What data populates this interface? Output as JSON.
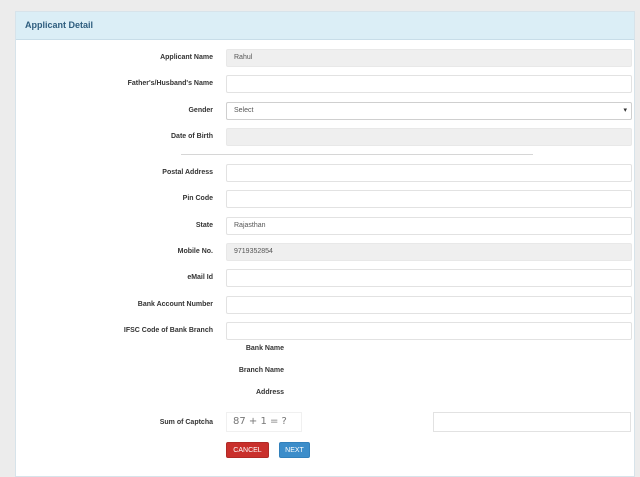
{
  "panel": {
    "title": "Applicant Detail"
  },
  "form": {
    "applicant_name": {
      "label": "Applicant Name",
      "value": "Rahul"
    },
    "father_name": {
      "label": "Father's/Husband's Name",
      "value": ""
    },
    "gender": {
      "label": "Gender",
      "value": "Select",
      "caret": "▾"
    },
    "dob": {
      "label": "Date of Birth",
      "value": ""
    },
    "postal_address": {
      "label": "Postal Address",
      "value": ""
    },
    "pin_code": {
      "label": "Pin Code",
      "value": ""
    },
    "state": {
      "label": "State",
      "value": "Rajasthan"
    },
    "mobile": {
      "label": "Mobile No.",
      "value": "9719352854"
    },
    "email": {
      "label": "eMail Id",
      "value": ""
    },
    "bank_account": {
      "label": "Bank Account Number",
      "value": ""
    },
    "ifsc": {
      "label": "IFSC Code of Bank Branch",
      "value": ""
    }
  },
  "bank": {
    "bank_name_label": "Bank Name",
    "branch_name_label": "Branch Name",
    "address_label": "Address"
  },
  "captcha": {
    "label": "Sum of Captcha",
    "question": "87 + 1 = ?",
    "answer": ""
  },
  "buttons": {
    "cancel": "CANCEL",
    "next": "NEXT"
  },
  "colors": {
    "cancel": "#c9302c",
    "next": "#3c8dca",
    "header": "#dbeef6"
  }
}
